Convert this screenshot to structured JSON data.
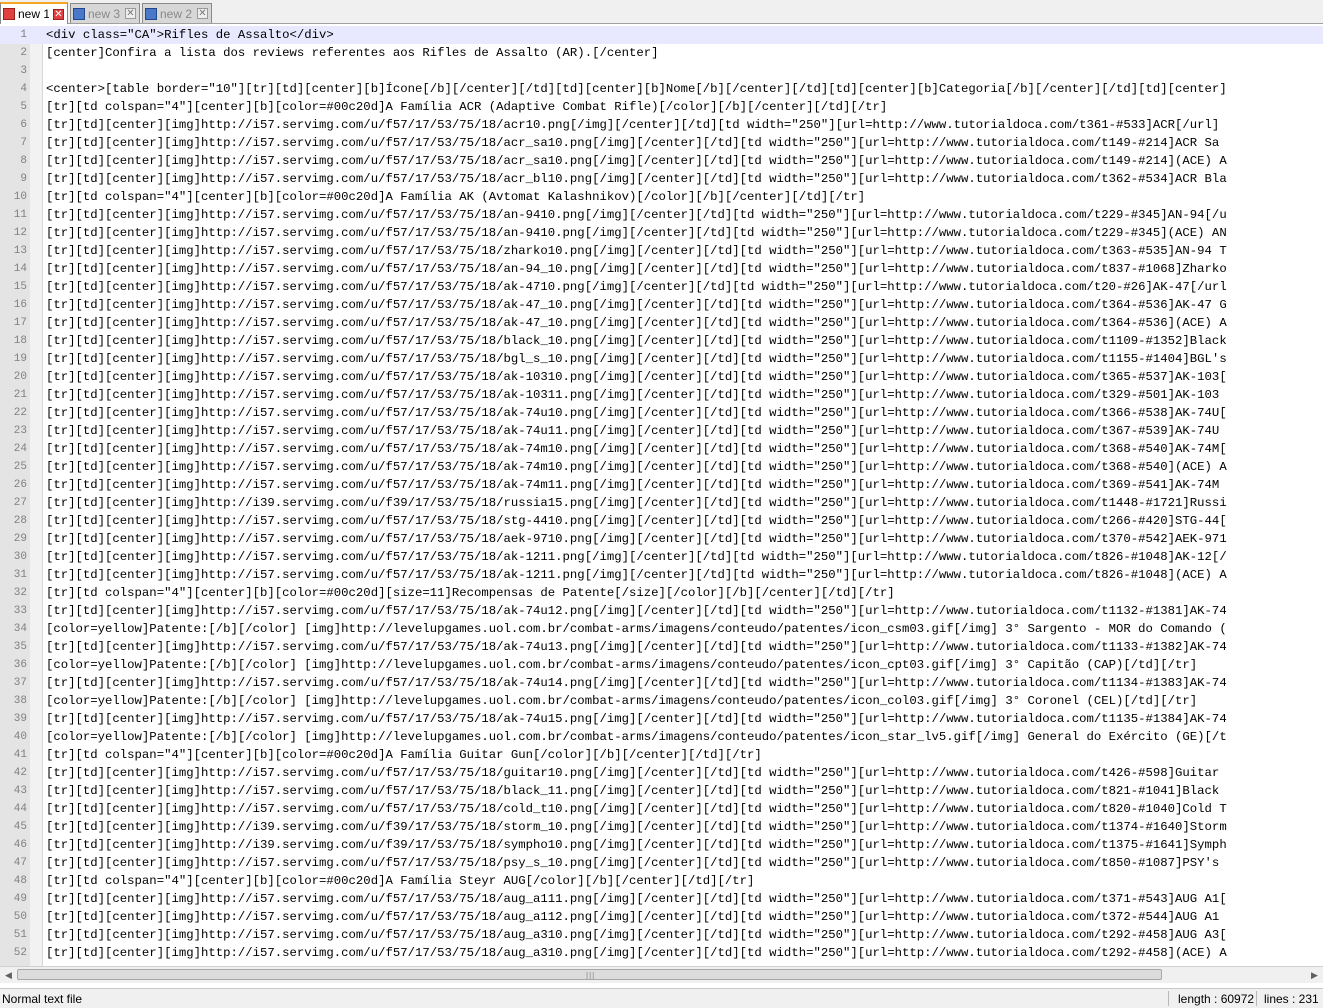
{
  "tabs": [
    {
      "label": "new  1",
      "active": true
    },
    {
      "label": "new  3",
      "active": false
    },
    {
      "label": "new  2",
      "active": false
    }
  ],
  "editor": {
    "lines": [
      {
        "n": "1",
        "text": "<div class=\"CA\">Rifles de Assalto</div>"
      },
      {
        "n": "2",
        "text": "[center]Confira a lista dos reviews referentes aos Rifles de Assalto (AR).[/center]"
      },
      {
        "n": "3",
        "text": ""
      },
      {
        "n": "4",
        "text": "<center>[table border=\"10\"][tr][td][center][b]Ícone[/b][/center][/td][td][center][b]Nome[/b][/center][/td][td][center][b]Categoria[/b][/center][/td][td][center]"
      },
      {
        "n": "5",
        "text": "[tr][td colspan=\"4\"][center][b][color=#00c20d]A Família ACR (Adaptive Combat Rifle)[/color][/b][/center][/td][/tr]"
      },
      {
        "n": "6",
        "text": "[tr][td][center][img]http://i57.servimg.com/u/f57/17/53/75/18/acr10.png[/img][/center][/td][td width=\"250\"][url=http://www.tutorialdoca.com/t361-#533]ACR[/url]"
      },
      {
        "n": "7",
        "text": "[tr][td][center][img]http://i57.servimg.com/u/f57/17/53/75/18/acr_sa10.png[/img][/center][/td][td width=\"250\"][url=http://www.tutorialdoca.com/t149-#214]ACR Sa"
      },
      {
        "n": "8",
        "text": "[tr][td][center][img]http://i57.servimg.com/u/f57/17/53/75/18/acr_sa10.png[/img][/center][/td][td width=\"250\"][url=http://www.tutorialdoca.com/t149-#214](ACE) A"
      },
      {
        "n": "9",
        "text": "[tr][td][center][img]http://i57.servimg.com/u/f57/17/53/75/18/acr_bl10.png[/img][/center][/td][td width=\"250\"][url=http://www.tutorialdoca.com/t362-#534]ACR Bla"
      },
      {
        "n": "10",
        "text": "[tr][td colspan=\"4\"][center][b][color=#00c20d]A Família AK (Avtomat Kalashnikov)[/color][/b][/center][/td][/tr]"
      },
      {
        "n": "11",
        "text": "[tr][td][center][img]http://i57.servimg.com/u/f57/17/53/75/18/an-9410.png[/img][/center][/td][td width=\"250\"][url=http://www.tutorialdoca.com/t229-#345]AN-94[/u"
      },
      {
        "n": "12",
        "text": "[tr][td][center][img]http://i57.servimg.com/u/f57/17/53/75/18/an-9410.png[/img][/center][/td][td width=\"250\"][url=http://www.tutorialdoca.com/t229-#345](ACE) AN"
      },
      {
        "n": "13",
        "text": "[tr][td][center][img]http://i57.servimg.com/u/f57/17/53/75/18/zharko10.png[/img][/center][/td][td width=\"250\"][url=http://www.tutorialdoca.com/t363-#535]AN-94 T"
      },
      {
        "n": "14",
        "text": "[tr][td][center][img]http://i57.servimg.com/u/f57/17/53/75/18/an-94_10.png[/img][/center][/td][td width=\"250\"][url=http://www.tutorialdoca.com/t837-#1068]Zharko"
      },
      {
        "n": "15",
        "text": "[tr][td][center][img]http://i57.servimg.com/u/f57/17/53/75/18/ak-4710.png[/img][/center][/td][td width=\"250\"][url=http://www.tutorialdoca.com/t20-#26]AK-47[/url"
      },
      {
        "n": "16",
        "text": "[tr][td][center][img]http://i57.servimg.com/u/f57/17/53/75/18/ak-47_10.png[/img][/center][/td][td width=\"250\"][url=http://www.tutorialdoca.com/t364-#536]AK-47 G"
      },
      {
        "n": "17",
        "text": "[tr][td][center][img]http://i57.servimg.com/u/f57/17/53/75/18/ak-47_10.png[/img][/center][/td][td width=\"250\"][url=http://www.tutorialdoca.com/t364-#536](ACE) A"
      },
      {
        "n": "18",
        "text": "[tr][td][center][img]http://i57.servimg.com/u/f57/17/53/75/18/black_10.png[/img][/center][/td][td width=\"250\"][url=http://www.tutorialdoca.com/t1109-#1352]Black"
      },
      {
        "n": "19",
        "text": "[tr][td][center][img]http://i57.servimg.com/u/f57/17/53/75/18/bgl_s_10.png[/img][/center][/td][td width=\"250\"][url=http://www.tutorialdoca.com/t1155-#1404]BGL's"
      },
      {
        "n": "20",
        "text": "[tr][td][center][img]http://i57.servimg.com/u/f57/17/53/75/18/ak-10310.png[/img][/center][/td][td width=\"250\"][url=http://www.tutorialdoca.com/t365-#537]AK-103["
      },
      {
        "n": "21",
        "text": "[tr][td][center][img]http://i57.servimg.com/u/f57/17/53/75/18/ak-10311.png[/img][/center][/td][td width=\"250\"][url=http://www.tutorialdoca.com/t329-#501]AK-103 "
      },
      {
        "n": "22",
        "text": "[tr][td][center][img]http://i57.servimg.com/u/f57/17/53/75/18/ak-74u10.png[/img][/center][/td][td width=\"250\"][url=http://www.tutorialdoca.com/t366-#538]AK-74U["
      },
      {
        "n": "23",
        "text": "[tr][td][center][img]http://i57.servimg.com/u/f57/17/53/75/18/ak-74u11.png[/img][/center][/td][td width=\"250\"][url=http://www.tutorialdoca.com/t367-#539]AK-74U "
      },
      {
        "n": "24",
        "text": "[tr][td][center][img]http://i57.servimg.com/u/f57/17/53/75/18/ak-74m10.png[/img][/center][/td][td width=\"250\"][url=http://www.tutorialdoca.com/t368-#540]AK-74M["
      },
      {
        "n": "25",
        "text": "[tr][td][center][img]http://i57.servimg.com/u/f57/17/53/75/18/ak-74m10.png[/img][/center][/td][td width=\"250\"][url=http://www.tutorialdoca.com/t368-#540](ACE) A"
      },
      {
        "n": "26",
        "text": "[tr][td][center][img]http://i57.servimg.com/u/f57/17/53/75/18/ak-74m11.png[/img][/center][/td][td width=\"250\"][url=http://www.tutorialdoca.com/t369-#541]AK-74M "
      },
      {
        "n": "27",
        "text": "[tr][td][center][img]http://i39.servimg.com/u/f39/17/53/75/18/russia15.png[/img][/center][/td][td width=\"250\"][url=http://www.tutorialdoca.com/t1448-#1721]Russi"
      },
      {
        "n": "28",
        "text": "[tr][td][center][img]http://i57.servimg.com/u/f57/17/53/75/18/stg-4410.png[/img][/center][/td][td width=\"250\"][url=http://www.tutorialdoca.com/t266-#420]STG-44["
      },
      {
        "n": "29",
        "text": "[tr][td][center][img]http://i57.servimg.com/u/f57/17/53/75/18/aek-9710.png[/img][/center][/td][td width=\"250\"][url=http://www.tutorialdoca.com/t370-#542]AEK-971"
      },
      {
        "n": "30",
        "text": "[tr][td][center][img]http://i57.servimg.com/u/f57/17/53/75/18/ak-1211.png[/img][/center][/td][td width=\"250\"][url=http://www.tutorialdoca.com/t826-#1048]AK-12[/"
      },
      {
        "n": "31",
        "text": "[tr][td][center][img]http://i57.servimg.com/u/f57/17/53/75/18/ak-1211.png[/img][/center][/td][td width=\"250\"][url=http://www.tutorialdoca.com/t826-#1048](ACE) A"
      },
      {
        "n": "32",
        "text": "[tr][td colspan=\"4\"][center][b][color=#00c20d][size=11]Recompensas de Patente[/size][/color][/b][/center][/td][/tr]"
      },
      {
        "n": "33",
        "text": "[tr][td][center][img]http://i57.servimg.com/u/f57/17/53/75/18/ak-74u12.png[/img][/center][/td][td width=\"250\"][url=http://www.tutorialdoca.com/t1132-#1381]AK-74"
      },
      {
        "n": "34",
        "text": "[color=yellow]Patente:[/b][/color] [img]http://levelupgames.uol.com.br/combat-arms/imagens/conteudo/patentes/icon_csm03.gif[/img] 3° Sargento - MOR do Comando ("
      },
      {
        "n": "35",
        "text": "[tr][td][center][img]http://i57.servimg.com/u/f57/17/53/75/18/ak-74u13.png[/img][/center][/td][td width=\"250\"][url=http://www.tutorialdoca.com/t1133-#1382]AK-74"
      },
      {
        "n": "36",
        "text": "[color=yellow]Patente:[/b][/color] [img]http://levelupgames.uol.com.br/combat-arms/imagens/conteudo/patentes/icon_cpt03.gif[/img] 3° Capitão (CAP)[/td][/tr]"
      },
      {
        "n": "37",
        "text": "[tr][td][center][img]http://i57.servimg.com/u/f57/17/53/75/18/ak-74u14.png[/img][/center][/td][td width=\"250\"][url=http://www.tutorialdoca.com/t1134-#1383]AK-74"
      },
      {
        "n": "38",
        "text": "[color=yellow]Patente:[/b][/color] [img]http://levelupgames.uol.com.br/combat-arms/imagens/conteudo/patentes/icon_col03.gif[/img] 3° Coronel (CEL)[/td][/tr]"
      },
      {
        "n": "39",
        "text": "[tr][td][center][img]http://i57.servimg.com/u/f57/17/53/75/18/ak-74u15.png[/img][/center][/td][td width=\"250\"][url=http://www.tutorialdoca.com/t1135-#1384]AK-74"
      },
      {
        "n": "40",
        "text": "[color=yellow]Patente:[/b][/color] [img]http://levelupgames.uol.com.br/combat-arms/imagens/conteudo/patentes/icon_star_lv5.gif[/img] General do Exército (GE)[/t"
      },
      {
        "n": "41",
        "text": "[tr][td colspan=\"4\"][center][b][color=#00c20d]A Família Guitar Gun[/color][/b][/center][/td][/tr]"
      },
      {
        "n": "42",
        "text": "[tr][td][center][img]http://i57.servimg.com/u/f57/17/53/75/18/guitar10.png[/img][/center][/td][td width=\"250\"][url=http://www.tutorialdoca.com/t426-#598]Guitar "
      },
      {
        "n": "43",
        "text": "[tr][td][center][img]http://i57.servimg.com/u/f57/17/53/75/18/black_11.png[/img][/center][/td][td width=\"250\"][url=http://www.tutorialdoca.com/t821-#1041]Black "
      },
      {
        "n": "44",
        "text": "[tr][td][center][img]http://i57.servimg.com/u/f57/17/53/75/18/cold_t10.png[/img][/center][/td][td width=\"250\"][url=http://www.tutorialdoca.com/t820-#1040]Cold T"
      },
      {
        "n": "45",
        "text": "[tr][td][center][img]http://i39.servimg.com/u/f39/17/53/75/18/storm_10.png[/img][/center][/td][td width=\"250\"][url=http://www.tutorialdoca.com/t1374-#1640]Storm"
      },
      {
        "n": "46",
        "text": "[tr][td][center][img]http://i39.servimg.com/u/f39/17/53/75/18/sympho10.png[/img][/center][/td][td width=\"250\"][url=http://www.tutorialdoca.com/t1375-#1641]Symph"
      },
      {
        "n": "47",
        "text": "[tr][td][center][img]http://i57.servimg.com/u/f57/17/53/75/18/psy_s_10.png[/img][/center][/td][td width=\"250\"][url=http://www.tutorialdoca.com/t850-#1087]PSY's "
      },
      {
        "n": "48",
        "text": "[tr][td colspan=\"4\"][center][b][color=#00c20d]A Família Steyr AUG[/color][/b][/center][/td][/tr]"
      },
      {
        "n": "49",
        "text": "[tr][td][center][img]http://i57.servimg.com/u/f57/17/53/75/18/aug_a111.png[/img][/center][/td][td width=\"250\"][url=http://www.tutorialdoca.com/t371-#543]AUG A1["
      },
      {
        "n": "50",
        "text": "[tr][td][center][img]http://i57.servimg.com/u/f57/17/53/75/18/aug_a112.png[/img][/center][/td][td width=\"250\"][url=http://www.tutorialdoca.com/t372-#544]AUG A1 "
      },
      {
        "n": "51",
        "text": "[tr][td][center][img]http://i57.servimg.com/u/f57/17/53/75/18/aug_a310.png[/img][/center][/td][td width=\"250\"][url=http://www.tutorialdoca.com/t292-#458]AUG A3["
      },
      {
        "n": "52",
        "text": "[tr][td][center][img]http://i57.servimg.com/u/f57/17/53/75/18/aug_a310.png[/img][/center][/td][td width=\"250\"][url=http://www.tutorialdoca.com/t292-#458](ACE) A"
      }
    ]
  },
  "statusbar": {
    "file_type": "Normal text file",
    "length": "length : 60972",
    "lines": "lines : 231"
  },
  "scrollbar": {
    "grip_icon": "grip-icon"
  },
  "colors": {
    "current_line": "#e8e8ff",
    "gutter": "#e4e4e4",
    "active_tab_accent": "#f5a623"
  }
}
